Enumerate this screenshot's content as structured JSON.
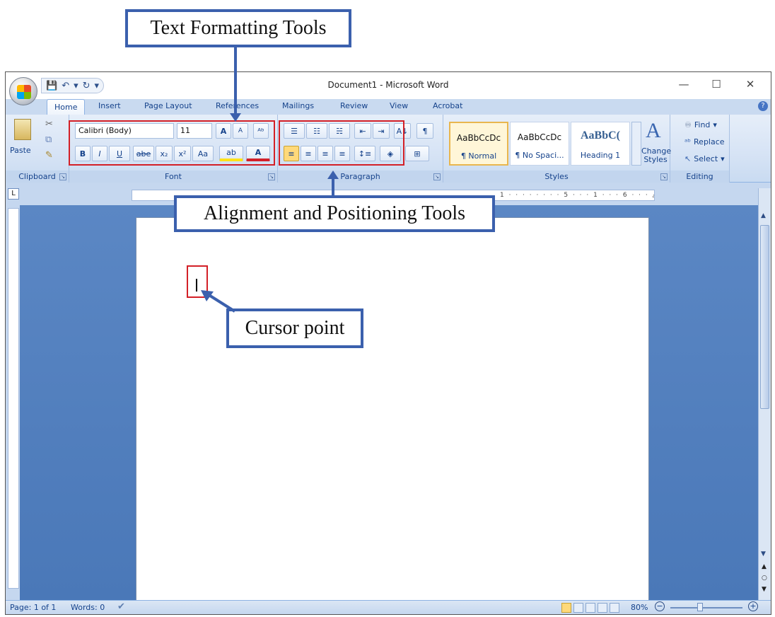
{
  "callouts": {
    "text_formatting": "Text Formatting Tools",
    "alignment": "Alignment and Positioning Tools",
    "cursor": "Cursor point"
  },
  "window": {
    "title": "Document1 - Microsoft Word",
    "minimize": "—",
    "maximize": "☐",
    "close": "✕"
  },
  "qat": {
    "save": "💾",
    "undo": "↶",
    "undo_drop": "▾",
    "redo": "↻",
    "customize": "▾"
  },
  "tabs": [
    "Home",
    "Insert",
    "Page Layout",
    "References",
    "Mailings",
    "Review",
    "View",
    "Acrobat"
  ],
  "clipboard": {
    "label": "Clipboard",
    "paste": "Paste",
    "cut": "✂",
    "copy": "⧉",
    "painter": "✎"
  },
  "font": {
    "label": "Font",
    "family": "Calibri (Body)",
    "size": "11",
    "grow": "A",
    "shrink": "A",
    "clear": "ᴬᵇ",
    "bold": "B",
    "italic": "I",
    "underline": "U",
    "strike": "abe",
    "subscript": "x₂",
    "superscript": "x²",
    "case": "Aa",
    "highlight": "ab",
    "color": "A"
  },
  "paragraph": {
    "label": "Paragraph",
    "bullets": "☰",
    "numbering": "☷",
    "multilevel": "☵",
    "decrease_indent": "⇤",
    "increase_indent": "⇥",
    "sort": "A↓",
    "pilcrow": "¶",
    "align_left": "≡",
    "center": "≡",
    "align_right": "≡",
    "justify": "≡",
    "line_spacing": "↕≡",
    "shading": "◈",
    "borders": "⊞"
  },
  "styles": {
    "label": "Styles",
    "items": [
      {
        "sample": "AaBbCcDc",
        "name": "¶ Normal"
      },
      {
        "sample": "AaBbCcDc",
        "name": "¶ No Spaci..."
      },
      {
        "sample": "AaBbC(",
        "name": "Heading 1"
      }
    ],
    "change_styles": "Change Styles"
  },
  "editing": {
    "label": "Editing",
    "find": "Find",
    "replace": "Replace",
    "select": "Select"
  },
  "ruler": {
    "corner": "L",
    "marks": "1 · · · · · · · · 5 · · · 1 · · · 6 · · · △ · · · 7 · · ·"
  },
  "status": {
    "page": "Page: 1 of 1",
    "words": "Words: 0",
    "zoom": "80%",
    "zoom_out": "−",
    "zoom_in": "+"
  },
  "colors": {
    "callout_border": "#3b60ad",
    "highlight_box": "#d32027",
    "workspace": "#5b87c4"
  }
}
